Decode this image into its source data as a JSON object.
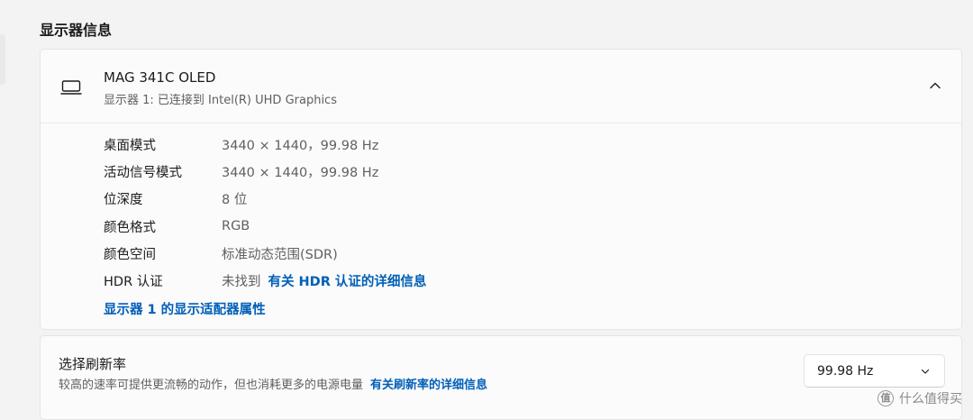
{
  "section": {
    "title": "显示器信息"
  },
  "display": {
    "name": "MAG 341C OLED",
    "subtitle": "显示器 1: 已连接到 Intel(R) UHD Graphics",
    "icon": "monitor-icon",
    "info": [
      {
        "label": "桌面模式",
        "value": "3440 × 1440，99.98 Hz"
      },
      {
        "label": "活动信号模式",
        "value": "3440 × 1440，99.98 Hz"
      },
      {
        "label": "位深度",
        "value": "8 位"
      },
      {
        "label": "颜色格式",
        "value": "RGB"
      },
      {
        "label": "颜色空间",
        "value": "标准动态范围(SDR)"
      },
      {
        "label": "HDR 认证",
        "value": "未找到",
        "link": "有关 HDR 认证的详细信息"
      }
    ],
    "adapter_link": "显示器 1 的显示适配器属性"
  },
  "refresh": {
    "title": "选择刷新率",
    "description": "较高的速率可提供更流畅的动作，但也消耗更多的电源电量",
    "link": "有关刷新率的详细信息",
    "selected": "99.98 Hz"
  },
  "watermark": {
    "logo": "值",
    "text": "什么值得买"
  },
  "colors": {
    "accent": "#005fb8",
    "background": "#f3f3f3",
    "card": "#fbfbfb"
  }
}
